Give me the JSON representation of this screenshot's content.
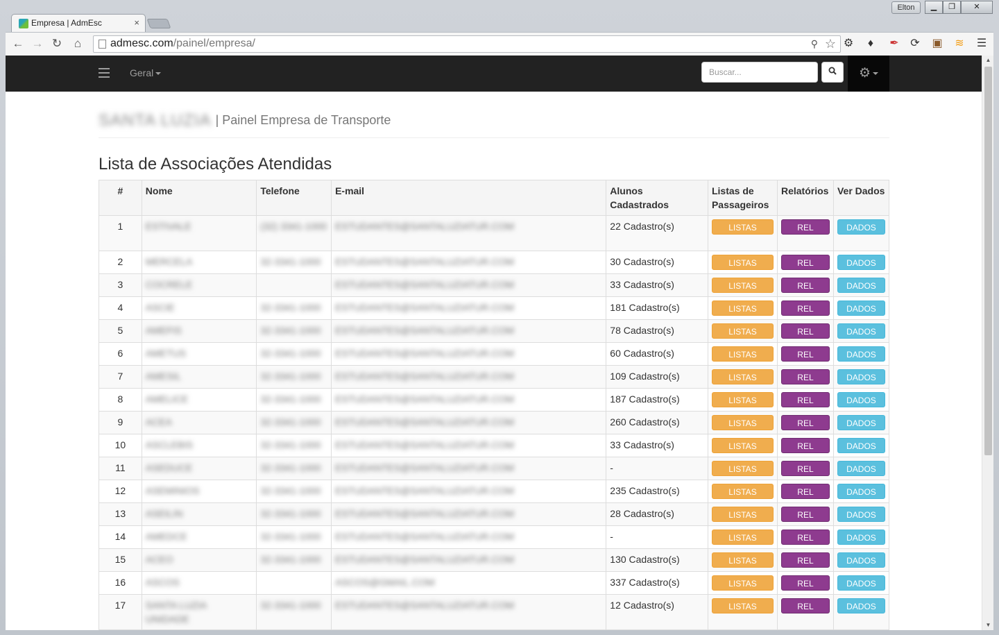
{
  "browser": {
    "tab_title": "Empresa | AdmEsc",
    "tab_close": "×",
    "user_badge": "Elton",
    "url_host": "admesc.com",
    "url_path": "/painel/empresa/",
    "window_buttons": [
      "▁",
      "❐",
      "✕"
    ]
  },
  "navbar": {
    "menu_label": "Geral",
    "search_placeholder": "Buscar...",
    "search_icon": "search-icon",
    "settings_icon": "gear-icon"
  },
  "header": {
    "company_name": "SANTA LUZIA",
    "subtitle": "| Painel Empresa de Transporte"
  },
  "section_title": "Lista de Associações Atendidas",
  "table": {
    "headers": [
      "#",
      "Nome",
      "Telefone",
      "E-mail",
      "Alunos Cadastrados",
      "Listas de Passageiros",
      "Relatórios",
      "Ver Dados"
    ],
    "button_labels": {
      "listas": "LISTAS",
      "rel": "REL",
      "dados": "DADOS"
    },
    "rows": [
      {
        "n": "1",
        "nome": "ESTIVALE",
        "telefone": "(32) 3341-1000",
        "email": "ESTUDANTES@SANTALUZIATUR.COM",
        "alunos": "22 Cadastro(s)"
      },
      {
        "n": "2",
        "nome": "MERCELA",
        "telefone": "32-3341-1000",
        "email": "ESTUDANTES@SANTALUZIATUR.COM",
        "alunos": "30 Cadastro(s)"
      },
      {
        "n": "3",
        "nome": "COCRELE",
        "telefone": "",
        "email": "ESTUDANTES@SANTALUZIATUR.COM",
        "alunos": "33 Cadastro(s)"
      },
      {
        "n": "4",
        "nome": "ASCIE",
        "telefone": "32-3341-1000",
        "email": "ESTUDANTES@SANTALUZIATUR.COM",
        "alunos": "181 Cadastro(s)"
      },
      {
        "n": "5",
        "nome": "AMEFIS",
        "telefone": "32-3341-1000",
        "email": "ESTUDANTES@SANTALUZIATUR.COM",
        "alunos": "78 Cadastro(s)"
      },
      {
        "n": "6",
        "nome": "AMETUS",
        "telefone": "32-3341-1000",
        "email": "ESTUDANTES@SANTALUZIATUR.COM",
        "alunos": "60 Cadastro(s)"
      },
      {
        "n": "7",
        "nome": "AMESIL",
        "telefone": "32-3341-1000",
        "email": "ESTUDANTES@SANTALUZIATUR.COM",
        "alunos": "109 Cadastro(s)"
      },
      {
        "n": "8",
        "nome": "AMELICE",
        "telefone": "32-3341-1000",
        "email": "ESTUDANTES@SANTALUZIATUR.COM",
        "alunos": "187 Cadastro(s)"
      },
      {
        "n": "9",
        "nome": "ACEA",
        "telefone": "32-3341-1000",
        "email": "ESTUDANTES@SANTALUZIATUR.COM",
        "alunos": "260 Cadastro(s)"
      },
      {
        "n": "10",
        "nome": "ASCLEBIS",
        "telefone": "32-3341-1000",
        "email": "ESTUDANTES@SANTALUZIATUR.COM",
        "alunos": "33 Cadastro(s)"
      },
      {
        "n": "11",
        "nome": "ASEDUCE",
        "telefone": "32-3341-1000",
        "email": "ESTUDANTES@SANTALUZIATUR.COM",
        "alunos": "-"
      },
      {
        "n": "12",
        "nome": "ASEMINIOS",
        "telefone": "32-3341-1000",
        "email": "ESTUDANTES@SANTALUZIATUR.COM",
        "alunos": "235 Cadastro(s)"
      },
      {
        "n": "13",
        "nome": "ASEILIN",
        "telefone": "32-3341-1000",
        "email": "ESTUDANTES@SANTALUZIATUR.COM",
        "alunos": "28 Cadastro(s)"
      },
      {
        "n": "14",
        "nome": "AMEDCE",
        "telefone": "32-3341-1000",
        "email": "ESTUDANTES@SANTALUZIATUR.COM",
        "alunos": "-"
      },
      {
        "n": "15",
        "nome": "ACEO",
        "telefone": "32-3341-1000",
        "email": "ESTUDANTES@SANTALUZIATUR.COM",
        "alunos": "130 Cadastro(s)"
      },
      {
        "n": "16",
        "nome": "ASCOS",
        "telefone": "",
        "email": "ASCOS@GMAIL.COM",
        "alunos": "337 Cadastro(s)"
      },
      {
        "n": "17",
        "nome": "SANTA LUZIA UNIDADE",
        "telefone": "32-3341-1000",
        "email": "ESTUDANTES@SANTALUZIATUR.COM",
        "alunos": "12 Cadastro(s)"
      }
    ]
  }
}
